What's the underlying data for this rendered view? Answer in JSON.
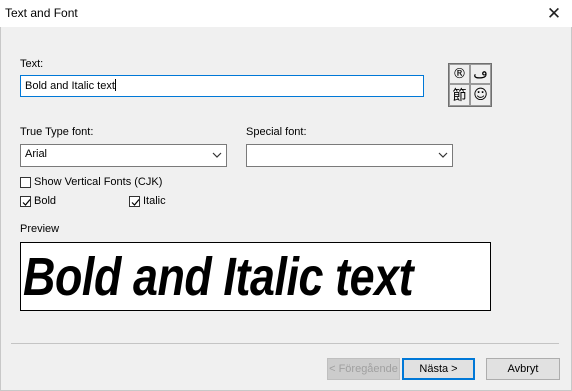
{
  "window": {
    "title": "Text and Font",
    "close_label": "✕"
  },
  "text_section": {
    "label": "Text:",
    "value": "Bold and Italic text"
  },
  "charmap": {
    "cells": [
      "®",
      "ڡ",
      "節",
      "☺"
    ]
  },
  "truetype": {
    "label": "True Type font:",
    "selected": "Arial"
  },
  "special": {
    "label": "Special font:",
    "selected": ""
  },
  "options": {
    "vertical": {
      "label": "Show Vertical Fonts (CJK)",
      "checked": false
    },
    "bold": {
      "label": "Bold",
      "checked": true
    },
    "italic": {
      "label": "Italic",
      "checked": true
    }
  },
  "preview": {
    "label": "Preview",
    "text": "Bold and Italic text"
  },
  "buttons": {
    "back": "< Föregående",
    "next": "Nästa >",
    "cancel": "Avbryt"
  }
}
